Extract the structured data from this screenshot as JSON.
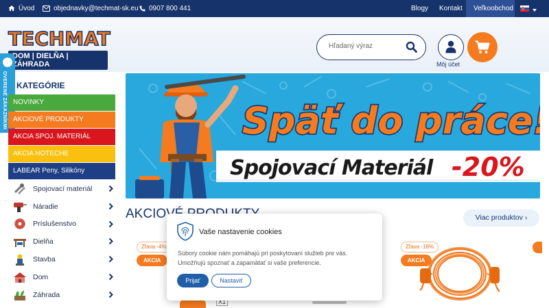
{
  "topbar": {
    "home": "Úvod",
    "email": "objednavky@techmat-sk.eu",
    "phone": "0907 800 441",
    "blog": "Blogy",
    "contact": "Kontakt",
    "wholesale": "Veľkoobchod",
    "language_flag": "sk-flag-icon"
  },
  "header": {
    "logo_word": "TECHMAT",
    "logo_tagline": "DOM | DIELŇA | ZÁHRADA",
    "search_placeholder": "Hľadaný výraz",
    "account_label": "Môj účet"
  },
  "trust_badge": "OVERENÉ ZÁKAZNÍKMI",
  "sidebar": {
    "title": "KATEGÓRIE",
    "promos": [
      {
        "label": "NOVINKY",
        "color": "#4aa93c"
      },
      {
        "label": "AKCIOVÉ PRODUKTY",
        "color": "#f47b20"
      },
      {
        "label": "AKCIA SPOJ. MATERIÁL",
        "color": "#d9161d"
      },
      {
        "label": "AKCIA HOTECHE",
        "color": "#f9c010"
      },
      {
        "label": "LABEAR Peny, Silikóny",
        "color": "#1e3f85"
      }
    ],
    "categories": [
      {
        "label": "Spojovací materiál",
        "icon": "screws-icon"
      },
      {
        "label": "Náradie",
        "icon": "drill-icon"
      },
      {
        "label": "Príslušenstvo",
        "icon": "saw-blade-icon"
      },
      {
        "label": "Dielňa",
        "icon": "workbench-icon"
      },
      {
        "label": "Stavba",
        "icon": "builder-icon"
      },
      {
        "label": "Dom",
        "icon": "house-icon"
      },
      {
        "label": "Záhrada",
        "icon": "garden-icon"
      }
    ]
  },
  "banner": {
    "headline": "Späť do práce!",
    "subline": "Spojovací Materiál",
    "discount": "-20%"
  },
  "products_section": {
    "title": "AKCIOVÉ PRODUKTY",
    "more_label": "Viac produktov ›",
    "products": [
      {
        "discount": "Zľava -4%",
        "badge": "AKCIA"
      },
      {
        "discount": "Zľava -16%",
        "badge": "AKCIA"
      }
    ],
    "partial_text": "X1"
  },
  "cookie": {
    "title": "Vaše nastavenie cookies",
    "text": "Súbory cookie nám pomáhajú pri poskytovaní služieb pre vás. Umožňujú spoznať a zapamätať si vaše preferencie.",
    "accept": "Prijať",
    "settings": "Nastaviť"
  },
  "colors": {
    "navy": "#17336b",
    "orange": "#f47b20",
    "light_blue": "#2a9fd8"
  }
}
